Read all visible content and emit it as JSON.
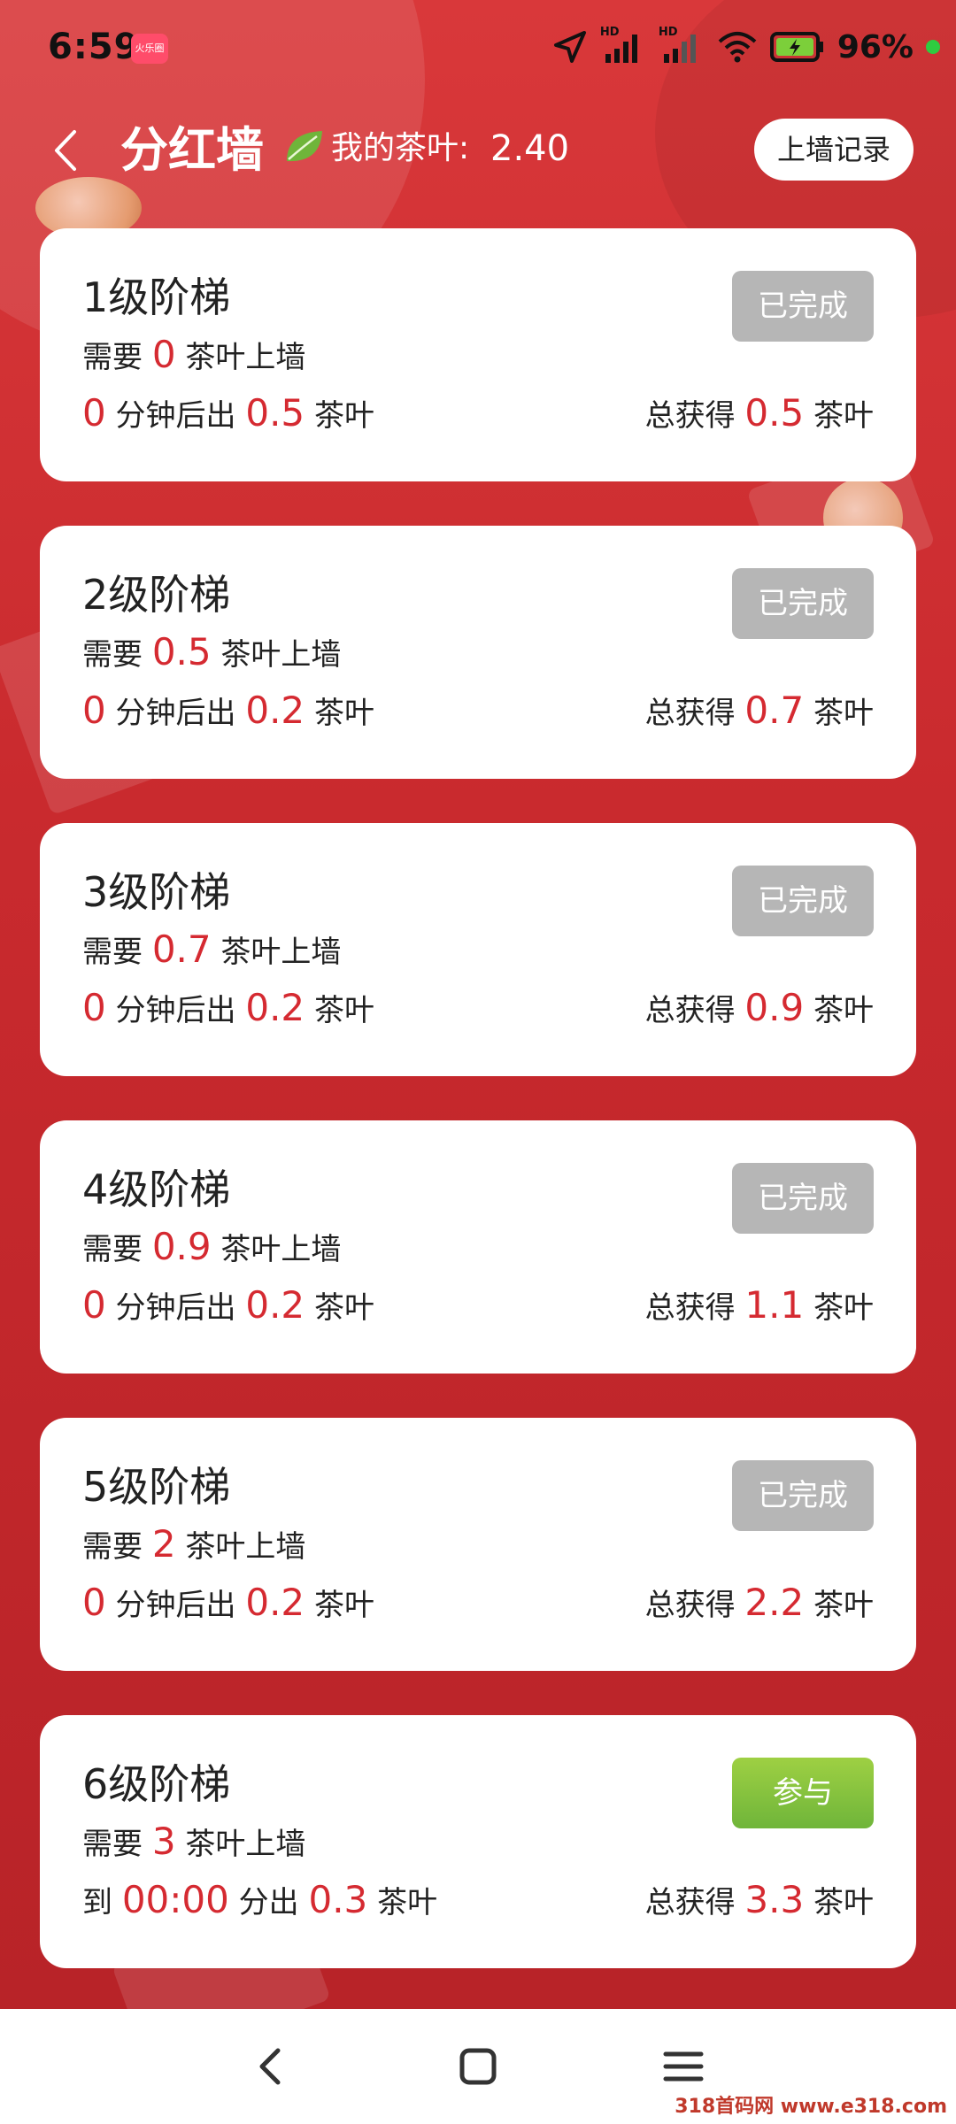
{
  "status_bar": {
    "time": "6:59",
    "app_badge": "火乐圈",
    "battery_text": "96%",
    "signal_labels": [
      "HD",
      "HD"
    ]
  },
  "header": {
    "title": "分红墙",
    "tea_label": "我的茶叶:",
    "tea_value": "2.40",
    "record_button": "上墙记录"
  },
  "tiers": [
    {
      "title": "1级阶梯",
      "need_prefix": "需要",
      "need_value": "0",
      "need_suffix": "茶叶上墙",
      "out_prefix": "",
      "out_value": "0",
      "out_mid": "分钟后出",
      "out_amount": "0.5",
      "out_suffix": "茶叶",
      "total_prefix": "总获得",
      "total_value": "0.5",
      "total_suffix": "茶叶",
      "status": "已完成"
    },
    {
      "title": "2级阶梯",
      "need_prefix": "需要",
      "need_value": "0.5",
      "need_suffix": "茶叶上墙",
      "out_prefix": "",
      "out_value": "0",
      "out_mid": "分钟后出",
      "out_amount": "0.2",
      "out_suffix": "茶叶",
      "total_prefix": "总获得",
      "total_value": "0.7",
      "total_suffix": "茶叶",
      "status": "已完成"
    },
    {
      "title": "3级阶梯",
      "need_prefix": "需要",
      "need_value": "0.7",
      "need_suffix": "茶叶上墙",
      "out_prefix": "",
      "out_value": "0",
      "out_mid": "分钟后出",
      "out_amount": "0.2",
      "out_suffix": "茶叶",
      "total_prefix": "总获得",
      "total_value": "0.9",
      "total_suffix": "茶叶",
      "status": "已完成"
    },
    {
      "title": "4级阶梯",
      "need_prefix": "需要",
      "need_value": "0.9",
      "need_suffix": "茶叶上墙",
      "out_prefix": "",
      "out_value": "0",
      "out_mid": "分钟后出",
      "out_amount": "0.2",
      "out_suffix": "茶叶",
      "total_prefix": "总获得",
      "total_value": "1.1",
      "total_suffix": "茶叶",
      "status": "已完成"
    },
    {
      "title": "5级阶梯",
      "need_prefix": "需要",
      "need_value": "2",
      "need_suffix": "茶叶上墙",
      "out_prefix": "",
      "out_value": "0",
      "out_mid": "分钟后出",
      "out_amount": "0.2",
      "out_suffix": "茶叶",
      "total_prefix": "总获得",
      "total_value": "2.2",
      "total_suffix": "茶叶",
      "status": "已完成"
    },
    {
      "title": "6级阶梯",
      "need_prefix": "需要",
      "need_value": "3",
      "need_suffix": "茶叶上墙",
      "out_prefix": "到",
      "out_value": "00:00",
      "out_mid": "分出",
      "out_amount": "0.3",
      "out_suffix": "茶叶",
      "total_prefix": "总获得",
      "total_value": "3.3",
      "total_suffix": "茶叶",
      "status": "参与"
    }
  ],
  "watermark": "318首码网 www.e318.com",
  "colors": {
    "background": "#c8262b",
    "accent_red": "#d52a31",
    "done_button": "#b6b6b6",
    "join_button": "#7cbf3c"
  }
}
